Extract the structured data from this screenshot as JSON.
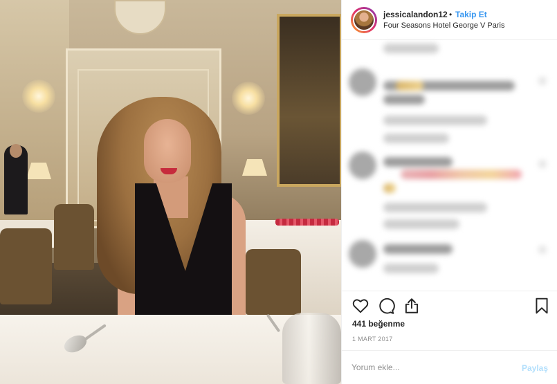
{
  "post": {
    "username": "jessicalandon12",
    "separator": "•",
    "follow_label": "Takip Et",
    "location": "Four Seasons Hotel George V Paris",
    "more_icon": "ellipsis-icon",
    "likes_text": "441 beğenme",
    "date_text": "1 MART 2017"
  },
  "actions": {
    "like_icon": "heart-icon",
    "comment_icon": "comment-bubble-icon",
    "share_icon": "share-upload-icon",
    "save_icon": "bookmark-icon"
  },
  "comment_box": {
    "placeholder": "Yorum ekle...",
    "submit_label": "Paylaş"
  },
  "colors": {
    "accent": "#3897f0",
    "submit_disabled": "#b2dffc",
    "muted": "#8e8e8e",
    "text": "#262626"
  }
}
